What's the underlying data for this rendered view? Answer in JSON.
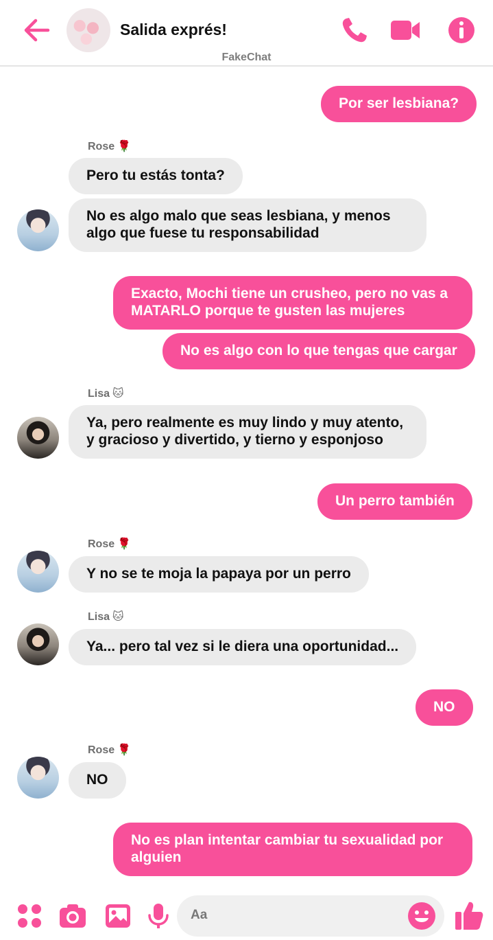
{
  "header": {
    "title": "Salida exprés!",
    "app_name": "FakeChat",
    "icons": [
      "back-arrow-icon",
      "phone-icon",
      "video-camera-icon",
      "info-icon"
    ]
  },
  "colors": {
    "accent": "#f8509a",
    "received_bubble": "#ebebeb",
    "sent_text": "#ffffff"
  },
  "senders": {
    "rose": "Rose",
    "rose_emoji": "🌹",
    "lisa": "Lisa",
    "lisa_emoji": "🐱"
  },
  "messages": [
    {
      "from": "me",
      "text": "Por ser lesbiana?"
    },
    {
      "from": "Rose",
      "text": "Pero tu estás tonta?"
    },
    {
      "from": "Rose",
      "text": "No es algo malo que seas lesbiana, y menos algo que fuese tu responsabilidad"
    },
    {
      "from": "me",
      "text": "Exacto, Mochi tiene un crusheo, pero no vas a MATARLO porque te gusten las mujeres"
    },
    {
      "from": "me",
      "text": "No es algo con lo que tengas que cargar"
    },
    {
      "from": "Lisa",
      "text": "Ya, pero realmente es muy lindo y muy atento, y gracioso y divertido, y tierno y esponjoso"
    },
    {
      "from": "me",
      "text": "Un perro también"
    },
    {
      "from": "Rose",
      "text": "Y no se te moja la papaya por un perro"
    },
    {
      "from": "Lisa",
      "text": "Ya... pero tal vez si le diera una oportunidad..."
    },
    {
      "from": "me",
      "text": "NO"
    },
    {
      "from": "Rose",
      "text": "NO"
    },
    {
      "from": "me",
      "text": "No es plan intentar cambiar tu sexualidad por alguien"
    }
  ],
  "composer": {
    "placeholder": "Aa",
    "icons": [
      "apps-icon",
      "camera-icon",
      "image-icon",
      "microphone-icon",
      "emoji-icon",
      "thumbs-up-icon"
    ]
  }
}
